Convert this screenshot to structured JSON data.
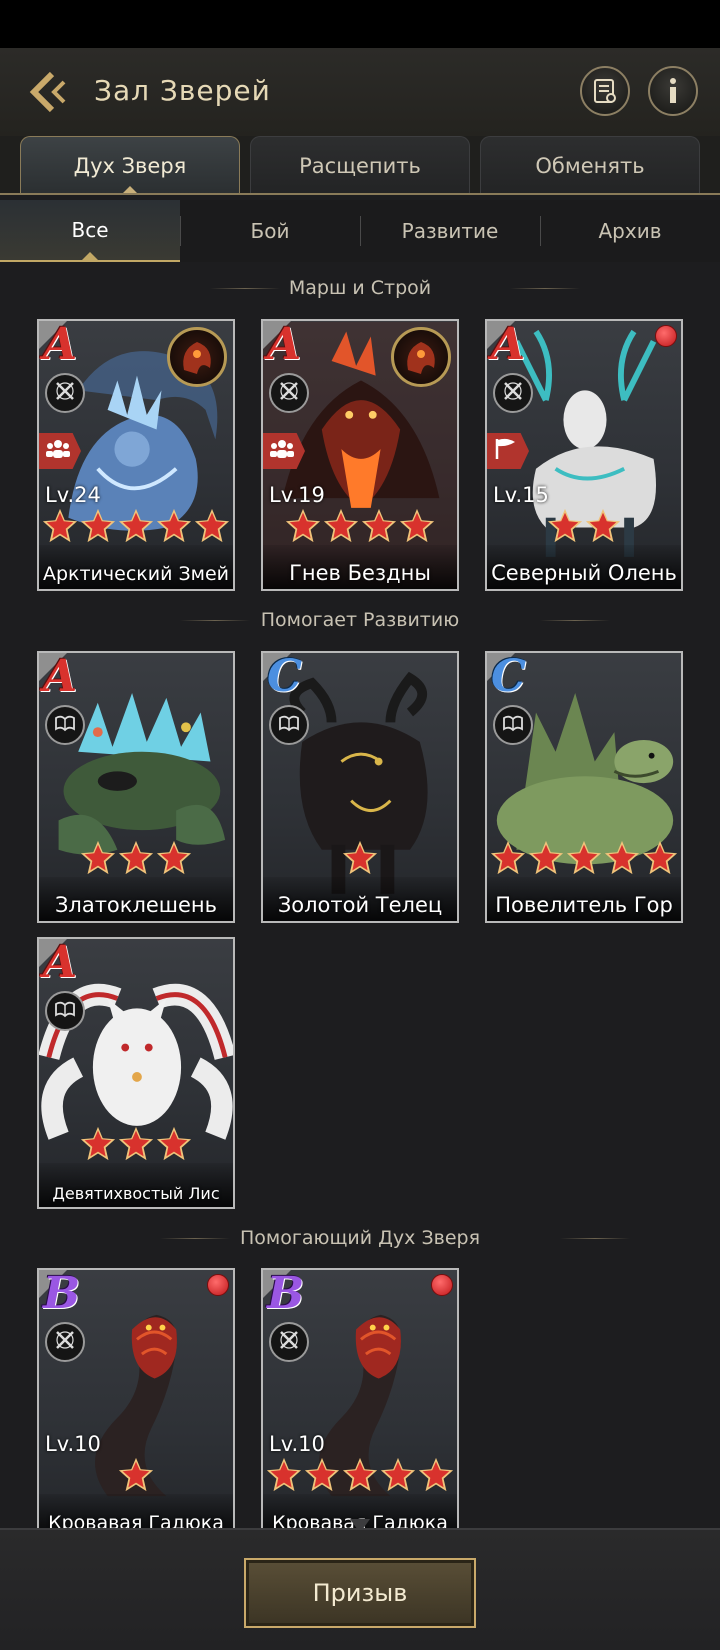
{
  "header": {
    "title": "Зал Зверей",
    "catalog_icon": "catalog-icon",
    "info_icon": "info-icon"
  },
  "tabs": [
    {
      "label": "Дух Зверя",
      "active": true
    },
    {
      "label": "Расщепить",
      "active": false
    },
    {
      "label": "Обменять",
      "active": false
    }
  ],
  "subtabs": [
    {
      "label": "Все",
      "active": true
    },
    {
      "label": "Бой",
      "active": false
    },
    {
      "label": "Развитие",
      "active": false
    },
    {
      "label": "Архив",
      "active": false
    }
  ],
  "sections": [
    {
      "title": "Марш и Строй"
    },
    {
      "title": "Помогает Развитию"
    },
    {
      "title": "Помогающий Дух Зверя"
    }
  ],
  "cards": [
    {
      "name": "Арктический Змей",
      "grade": "A",
      "level": "Lv.24",
      "stars": 5,
      "type_icon": "crossed-swords-icon",
      "role_tag": "group-icon",
      "gear": true,
      "red_dot": false,
      "art": "ice-dragon",
      "accent": "#7fa6d6"
    },
    {
      "name": "Гнев Бездны",
      "grade": "A",
      "level": "Lv.19",
      "stars": 4,
      "type_icon": "crossed-swords-icon",
      "role_tag": "group-icon",
      "gear": true,
      "red_dot": false,
      "art": "fire-dragon",
      "accent": "#e2552a"
    },
    {
      "name": "Северный Олень",
      "grade": "A",
      "level": "Lv.15",
      "stars": 2,
      "type_icon": "crossed-swords-icon",
      "role_tag": "flag-icon",
      "gear": false,
      "red_dot": true,
      "art": "deer",
      "accent": "#3dbdc1"
    },
    {
      "name": "Златоклешень",
      "grade": "A",
      "level": "",
      "stars": 3,
      "type_icon": "book-icon",
      "role_tag": "",
      "gear": false,
      "red_dot": false,
      "art": "crab",
      "accent": "#6fd0e4"
    },
    {
      "name": "Золотой Телец",
      "grade": "C",
      "level": "",
      "stars": 1,
      "type_icon": "book-icon",
      "role_tag": "",
      "gear": false,
      "red_dot": false,
      "art": "bull",
      "accent": "#d9b64a"
    },
    {
      "name": "Повелитель Гор",
      "grade": "C",
      "level": "",
      "stars": 5,
      "type_icon": "book-icon",
      "role_tag": "",
      "gear": false,
      "red_dot": false,
      "art": "turtle",
      "accent": "#8aa46a"
    },
    {
      "name": "Девятихвостый Лис",
      "grade": "A",
      "level": "",
      "stars": 3,
      "type_icon": "book-icon",
      "role_tag": "",
      "gear": false,
      "red_dot": false,
      "art": "fox",
      "accent": "#e6e6e6"
    },
    {
      "name": "Кровавая Гадюка",
      "grade": "B",
      "level": "Lv.10",
      "stars": 1,
      "type_icon": "crossed-swords-icon",
      "role_tag": "",
      "gear": false,
      "red_dot": true,
      "art": "cobra",
      "accent": "#c0392b"
    },
    {
      "name": "Кровавая Гадюка",
      "grade": "B",
      "level": "Lv.10",
      "stars": 5,
      "type_icon": "crossed-swords-icon",
      "role_tag": "",
      "gear": false,
      "red_dot": true,
      "art": "cobra",
      "accent": "#c0392b"
    }
  ],
  "footer": {
    "summon_label": "Призыв"
  },
  "colors": {
    "gold": "#c9a96a",
    "star_red": "#d8322d",
    "grade_A": "#d8322d",
    "grade_B": "#9a57e3",
    "grade_C": "#4c8fe0"
  }
}
